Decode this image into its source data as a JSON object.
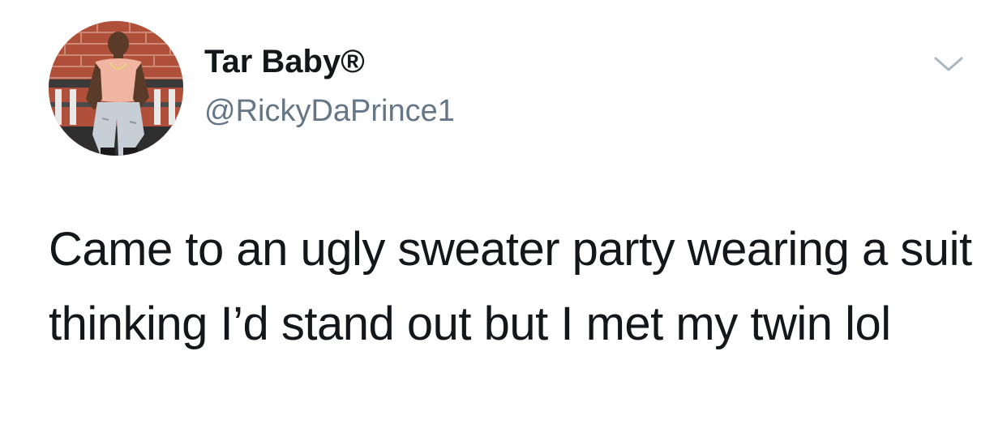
{
  "author": {
    "display_name": "Tar Baby®",
    "handle": "@RickyDaPrince1",
    "avatar": "profile-photo"
  },
  "menu": {
    "icon": "chevron-down-icon"
  },
  "tweet": {
    "text": "Came to an ugly sweater party wearing a suit thinking I’d stand out but I met my twin lol"
  },
  "colors": {
    "text": "#14171a",
    "handle": "#657786",
    "caret": "#aab8c2",
    "background": "#ffffff"
  }
}
